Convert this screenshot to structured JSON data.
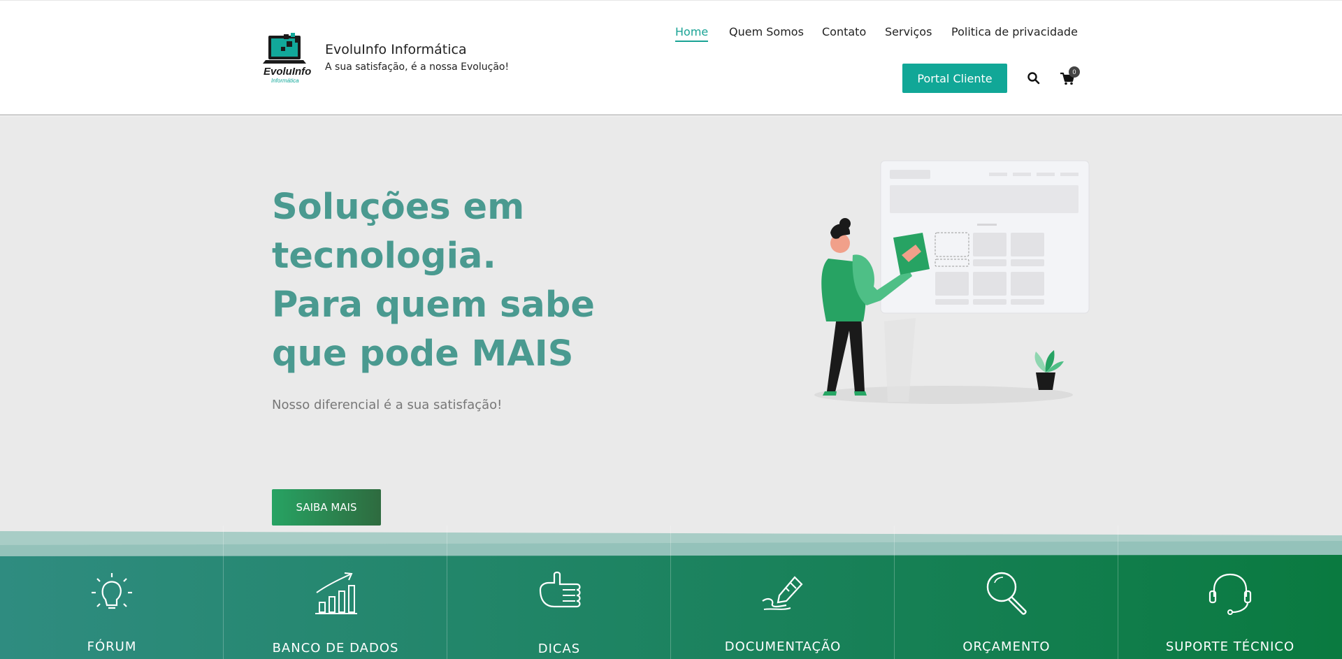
{
  "header": {
    "brand_name": "EvoluInfo Informática",
    "brand_tagline": "A sua satisfação, é a nossa Evolução!",
    "logo_text": "EvoluInfo",
    "logo_subtext": "Informática",
    "nav": [
      {
        "label": "Home",
        "active": true
      },
      {
        "label": "Quem Somos",
        "active": false
      },
      {
        "label": "Contato",
        "active": false
      },
      {
        "label": "Serviços",
        "active": false
      },
      {
        "label": "Politica de privacidade",
        "active": false
      }
    ],
    "portal_button": "Portal Cliente",
    "cart_count": "0",
    "accent_color": "#11a797"
  },
  "hero": {
    "title_lines": [
      "Soluções em",
      "tecnologia.",
      "Para quem sabe",
      "que pode MAIS"
    ],
    "subtitle": "Nosso diferencial é a sua satisfação!",
    "cta_button": "SAIBA MAIS",
    "title_color": "#4a9a90"
  },
  "services": [
    {
      "label": "FÓRUM",
      "icon": "lightbulb-icon"
    },
    {
      "label": "BANCO DE DADOS",
      "icon": "growth-chart-icon"
    },
    {
      "label": "DICAS",
      "icon": "thumbs-up-icon"
    },
    {
      "label": "DOCUMENTAÇÃO",
      "icon": "signature-pen-icon"
    },
    {
      "label": "ORÇAMENTO",
      "icon": "magnifier-icon"
    },
    {
      "label": "SUPORTE TÉCNICO",
      "icon": "headset-icon"
    }
  ]
}
